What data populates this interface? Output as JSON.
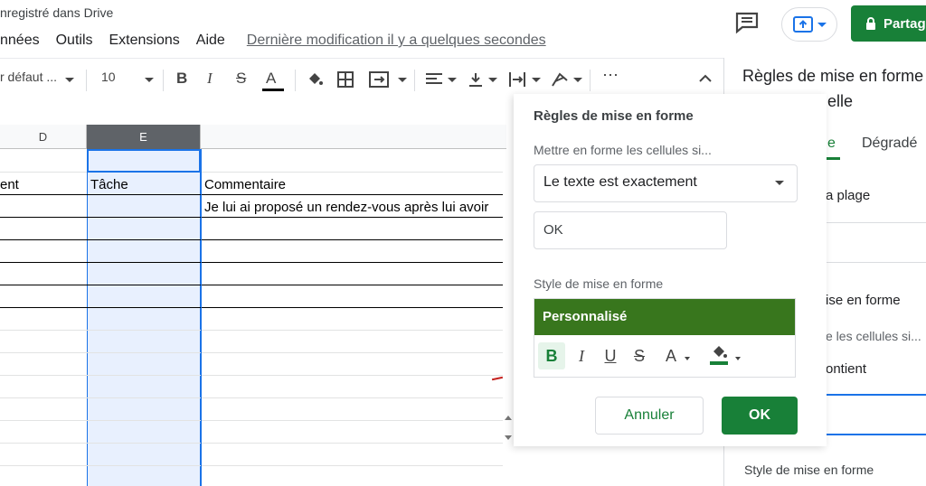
{
  "header": {
    "status": "nregistré dans Drive",
    "share_label": "Partag"
  },
  "menu": {
    "items": [
      "nnées",
      "Outils",
      "Extensions",
      "Aide"
    ],
    "last_modified": "Dernière modification il y a quelques secondes"
  },
  "toolbar": {
    "font": "r défaut ...",
    "font_size": "10",
    "bold": "B",
    "italic": "I",
    "strike": "S",
    "text_color": "A",
    "more": "⋯"
  },
  "grid": {
    "col_d": "D",
    "col_e": "E",
    "header_row": [
      "ent",
      "Tâche",
      "Commentaire"
    ],
    "row1_comment": "Je lui ai proposé un rendez-vous après lui avoir"
  },
  "right_panel": {
    "title_line1": "Règles de mise en forme",
    "title_line2": "elle",
    "tab_active": "e",
    "tab_gradient": "Dégradé",
    "range_label": "a plage",
    "rules_label": "ise en forme",
    "cells_if": "e les cellules si...",
    "condition": "ontient",
    "style_label": "Style de mise en forme"
  },
  "dialog": {
    "title": "Règles de mise en forme",
    "cells_if_label": "Mettre en forme les cellules si...",
    "condition": "Le texte est exactement",
    "value": "OK",
    "style_label": "Style de mise en forme",
    "style_name": "Personnalisé",
    "fmt_bold": "B",
    "fmt_italic": "I",
    "fmt_underline": "U",
    "fmt_strike": "S",
    "fmt_color": "A",
    "cancel": "Annuler",
    "ok": "OK"
  },
  "colors": {
    "accent_green": "#188038",
    "style_green": "#38761d",
    "selection_blue": "#1a73e8"
  }
}
